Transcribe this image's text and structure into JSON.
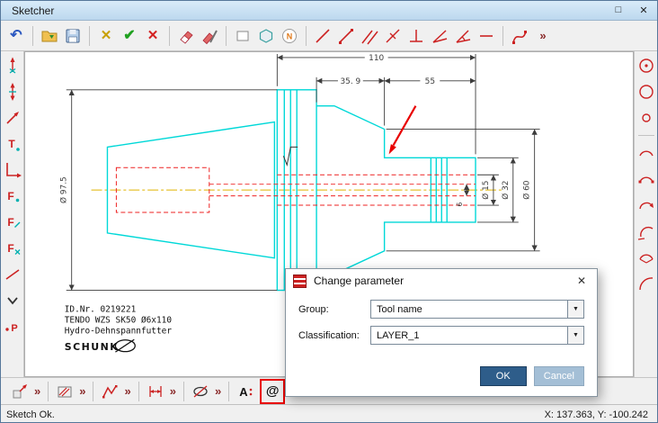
{
  "window": {
    "title": "Sketcher",
    "controls": {
      "maximize": "□",
      "close": "✕"
    }
  },
  "top_toolbar": {
    "undo": "↶",
    "discard": "✕",
    "apply": "✔",
    "delete": "✕",
    "ngon_letter": "N",
    "overflow": "»"
  },
  "rail_glyphs": {
    "t": "T",
    "f": "F",
    "p": "P"
  },
  "bottom_toolbar": {
    "overflow": "»",
    "text_tool": "A",
    "attribute_tool": "@",
    "attribute_menu": "@"
  },
  "drawing": {
    "dims": {
      "overall": "110",
      "left_section": "35. 9",
      "right_section": "55",
      "flange": "Ø 97.5",
      "bore": "Ø 15",
      "neck": "Ø 32",
      "shoulder": "Ø 60",
      "clamp": "6"
    },
    "title_block": {
      "id": "ID.Nr. 0219221",
      "name": "TENDO WZS SK50 Ø6x110",
      "type": "Hydro-Dehnspannfutter",
      "brand": "SCHUNK"
    }
  },
  "dialog": {
    "title": "Change parameter",
    "close": "✕",
    "caret": "▼",
    "group_label": "Group:",
    "group_value": "Tool name",
    "classification_label": "Classification:",
    "classification_value": "LAYER_1",
    "ok": "OK",
    "cancel": "Cancel"
  },
  "status_bar": {
    "message": "Sketch Ok.",
    "coordinates": "X: 137.363, Y: -100.242"
  },
  "colors": {
    "outline": "#00d8d8",
    "internal_red": "#ee2222",
    "centerline": "#e0b400",
    "dimension": "#3c3c3c",
    "highlight_box": "#e80000",
    "ok_button": "#2e5d8a",
    "cancel_button": "#a4bfd6"
  }
}
